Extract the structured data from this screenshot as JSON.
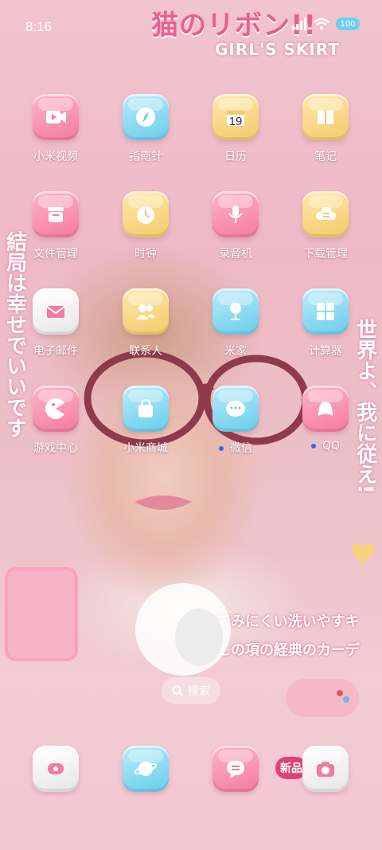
{
  "status_bar": {
    "time": "8:16",
    "battery_level": "100"
  },
  "wallpaper": {
    "title": "猫のリボン!!",
    "subtitle": "GIRL'S SKIRT",
    "left_vertical": "結局は幸せでいいです",
    "right_vertical": "世界よ、我に従え!",
    "line1": "でみにくい洗いやすキ",
    "line2": "この項の経典のカーデ",
    "badge": "新品"
  },
  "apps": [
    {
      "label": "小米视频",
      "icon": "video-icon",
      "color": "pink"
    },
    {
      "label": "指南针",
      "icon": "compass-icon",
      "color": "blue"
    },
    {
      "label": "日历",
      "icon": "calendar-icon",
      "color": "yellow",
      "day": "19"
    },
    {
      "label": "笔记",
      "icon": "notes-icon",
      "color": "yellow"
    },
    {
      "label": "文件管理",
      "icon": "folder-icon",
      "color": "pink"
    },
    {
      "label": "时钟",
      "icon": "clock-icon",
      "color": "yellow"
    },
    {
      "label": "录音机",
      "icon": "microphone-icon",
      "color": "pink"
    },
    {
      "label": "下载管理",
      "icon": "download-icon",
      "color": "yellow"
    },
    {
      "label": "电子邮件",
      "icon": "mail-icon",
      "color": "white"
    },
    {
      "label": "联系人",
      "icon": "contacts-icon",
      "color": "yellow"
    },
    {
      "label": "米家",
      "icon": "smart-home-icon",
      "color": "blue"
    },
    {
      "label": "计算器",
      "icon": "calculator-icon",
      "color": "blue"
    },
    {
      "label": "游戏中心",
      "icon": "game-icon",
      "color": "pink"
    },
    {
      "label": "小米商城",
      "icon": "shopping-bag-icon",
      "color": "blue"
    },
    {
      "label": "微信",
      "icon": "wechat-icon",
      "color": "blue",
      "new_dot": true
    },
    {
      "label": "QQ",
      "icon": "qq-icon",
      "color": "pink",
      "new_dot": true
    }
  ],
  "search": {
    "label": "搜索",
    "icon": "search-icon"
  },
  "dock": [
    {
      "name": "phone",
      "icon": "phone-icon",
      "color": "white"
    },
    {
      "name": "browser",
      "icon": "planet-icon",
      "color": "blue"
    },
    {
      "name": "messages",
      "icon": "message-icon",
      "color": "pink"
    },
    {
      "name": "camera",
      "icon": "camera-icon",
      "color": "white"
    }
  ],
  "colors": {
    "accent_pink": "#f47b9d",
    "accent_blue": "#68cde9",
    "accent_yellow": "#f5c96b",
    "dot_blue": "#2f6cf0"
  }
}
